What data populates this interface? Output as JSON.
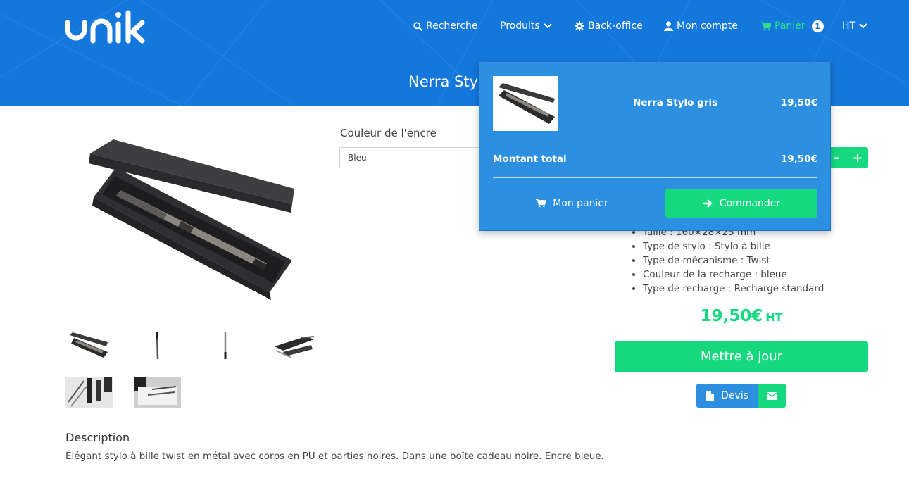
{
  "brand": {
    "logo_text": "unik"
  },
  "nav": {
    "search": "Recherche",
    "products": "Produits",
    "backoffice": "Back-office",
    "account": "Mon compte",
    "cart": "Panier",
    "cart_count": "1",
    "tax_mode": "HT"
  },
  "page": {
    "title": "Nerra Sty"
  },
  "product": {
    "option_label": "Couleur de l'encre",
    "option_value": "Bleu",
    "qty_minus": "-",
    "qty_plus": "+",
    "specs": [
      "Taille : 160×28×25 mm",
      "Type de stylo : Stylo à bille",
      "Type de mécanisme : Twist",
      "Couleur de la recharge : bleue",
      "Type de recharge : Recharge standard"
    ],
    "price": "19,50€",
    "price_unit": "HT",
    "update_button": "Mettre à jour",
    "quote_button": "Devis",
    "description_title": "Description",
    "description": "Élégant stylo à bille twist en métal avec corps en PU et parties noires. Dans une boîte cadeau noire. Encre bleue."
  },
  "cart_dropdown": {
    "item_name": "Nerra Stylo gris",
    "item_price": "19,50€",
    "total_label": "Montant total",
    "total_value": "19,50€",
    "view_cart": "Mon panier",
    "checkout": "Commander"
  },
  "colors": {
    "header_blue": "#1477dc",
    "accent_green": "#16d97f",
    "dropdown_blue": "#2d8fe0"
  },
  "icons": [
    "search-icon",
    "chevron-down-icon",
    "gear-icon",
    "user-icon",
    "cart-icon",
    "file-icon",
    "envelope-icon",
    "arrow-right-icon"
  ]
}
